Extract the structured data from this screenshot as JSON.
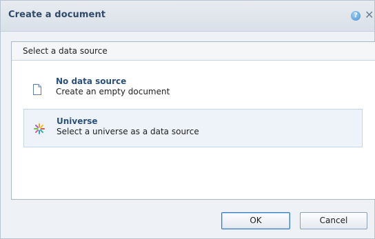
{
  "dialog": {
    "title": "Create a document",
    "help_icon": "help-icon",
    "close_icon": "close-icon",
    "close_glyph": "✕",
    "help_glyph": "?"
  },
  "panel": {
    "header_label": "Select a data source",
    "options": [
      {
        "title": "No data source",
        "description": "Create an empty document",
        "icon": "document-icon",
        "selected": false
      },
      {
        "title": "Universe",
        "description": "Select a universe as a data source",
        "icon": "universe-icon",
        "selected": true
      }
    ]
  },
  "buttons": {
    "ok_label": "OK",
    "cancel_label": "Cancel"
  },
  "colors": {
    "title_text": "#2f4a68",
    "option_title": "#2a4f7c",
    "selected_bg": "#edf3f9",
    "selected_border": "#c4d6e8",
    "default_button_border": "#3b7ac0"
  }
}
